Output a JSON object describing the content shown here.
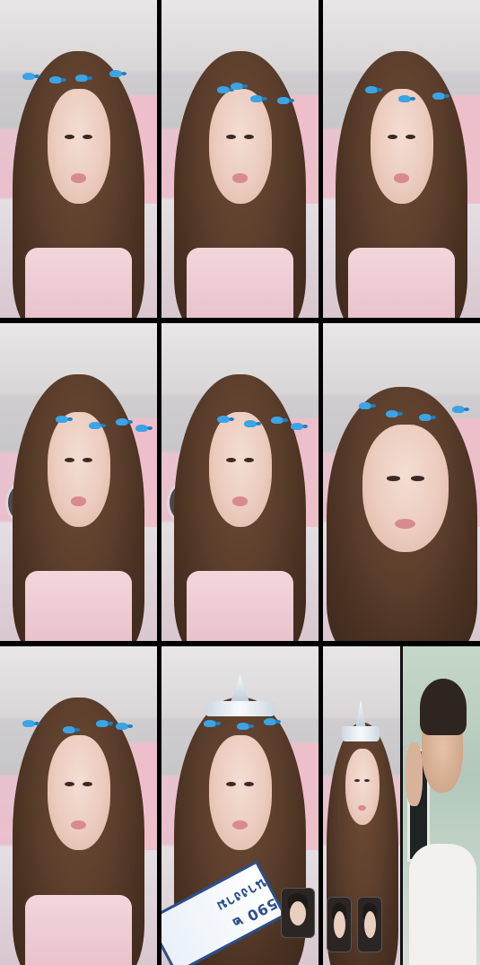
{
  "grid": {
    "rows": 3,
    "columns": 3
  },
  "tiles": [
    {
      "name": "tile-r1c1",
      "effect": "blue-birds"
    },
    {
      "name": "tile-r1c2",
      "effect": "blue-birds"
    },
    {
      "name": "tile-r1c3",
      "effect": "blue-birds"
    },
    {
      "name": "tile-r2c1",
      "effect": "blue-birds"
    },
    {
      "name": "tile-r2c2",
      "effect": "blue-birds"
    },
    {
      "name": "tile-r2c3",
      "effect": "blue-birds"
    },
    {
      "name": "tile-r3c1",
      "effect": "blue-birds"
    },
    {
      "name": "tile-r3c2",
      "effect": "crown-and-sash",
      "sash_text": "590 ๒ นางงาม"
    },
    {
      "name": "tile-r3c3",
      "effect": "crown-split-call"
    }
  ],
  "colors": {
    "divider": "#000000",
    "bird": "#3aa4e6",
    "sash_border": "#2b4f8c"
  }
}
